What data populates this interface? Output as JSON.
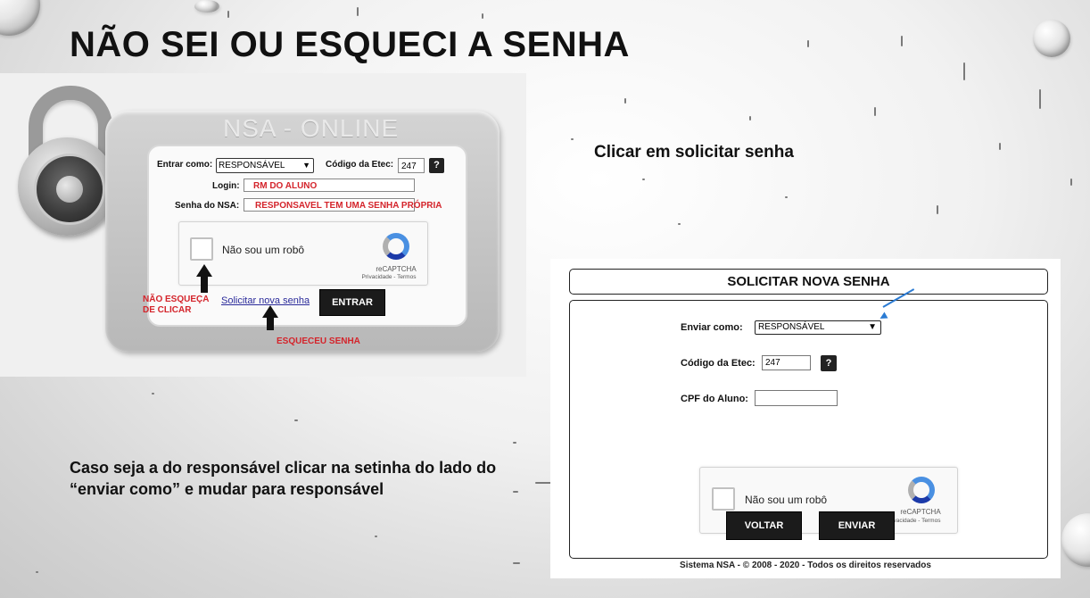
{
  "slide": {
    "title": "NÃO SEI OU ESQUECI A SENHA",
    "instruction_1": "Clicar em solicitar senha",
    "instruction_2": "Caso seja a do responsável clicar na setinha do lado do “enviar como” e mudar para responsável"
  },
  "login_panel": {
    "logo": "NSA - ONLINE",
    "entrar_label": "Entrar como:",
    "entrar_value": "RESPONSÁVEL",
    "codigo_label": "Código da Etec:",
    "codigo_value": "247",
    "help_button": "?",
    "login_label": "Login:",
    "login_value": "RM DO ALUNO",
    "senha_label": "Senha do NSA:",
    "senha_value": "RESPONSAVEL TEM UMA SENHA PRÓPRIA",
    "captcha_text": "Não sou um robô",
    "captcha_brand": "reCAPTCHA",
    "captcha_links": "Privacidade - Termos",
    "forgot_link": "Solicitar nova senha",
    "enter_button": "ENTRAR",
    "annotation_left": "NÃO ESQUEÇA DE CLICAR",
    "annotation_bottom": "ESQUECEU SENHA"
  },
  "solicit_panel": {
    "title": "SOLICITAR NOVA SENHA",
    "enviar_label": "Enviar como:",
    "enviar_value": "RESPONSÁVEL",
    "codigo_label": "Código da Etec:",
    "codigo_value": "247",
    "help_button": "?",
    "cpf_label": "CPF do Aluno:",
    "cpf_value": "",
    "captcha_text": "Não sou um robô",
    "captcha_brand": "reCAPTCHA",
    "captcha_links": "Privacidade - Termos",
    "back_button": "VOLTAR",
    "send_button": "ENVIAR",
    "footer": "Sistema NSA  -  © 2008 - 2020  -  Todos os direitos reservados"
  },
  "colors": {
    "annotation_red": "#d4242b",
    "arrow_blue": "#2b7bd3",
    "button_dark": "#1b1b1b"
  }
}
